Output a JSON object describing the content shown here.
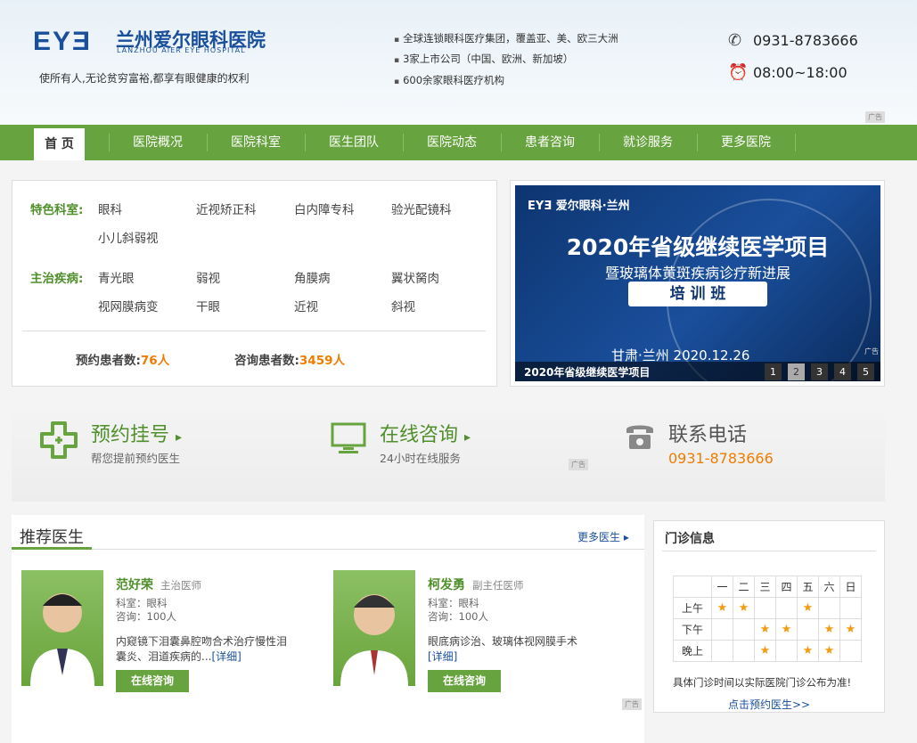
{
  "header": {
    "logo_mark": "EYƎ",
    "hospital_name": "兰州爱尔眼科医院",
    "hospital_name_en": "LANZHOU AIER EYE HOSPITAL",
    "slogan": "使所有人,无论贫穷富裕,都享有眼健康的权利",
    "highlights": [
      "全球连锁眼科医疗集团，覆盖亚、美、欧三大洲",
      "3家上市公司（中国、欧洲、新加坡）",
      "600余家眼科医疗机构"
    ],
    "phone": "0931-8783666",
    "hours": "08:00~18:00",
    "ad_label": "广告"
  },
  "nav": {
    "items": [
      "首 页",
      "医院概况",
      "医院科室",
      "医生团队",
      "医院动态",
      "患者咨询",
      "就诊服务",
      "更多医院"
    ]
  },
  "departments": {
    "featured_label": "特色科室:",
    "featured": [
      "眼科",
      "近视矫正科",
      "白内障专科",
      "验光配镜科",
      "小儿斜弱视"
    ],
    "diseases_label": "主治疾病:",
    "diseases": [
      "青光眼",
      "弱视",
      "角膜病",
      "翼状胬肉",
      "视网膜病变",
      "干眼",
      "近视",
      "斜视"
    ],
    "appt_label": "预约患者数:",
    "appt_count": "76人",
    "consult_label": "咨询患者数:",
    "consult_count": "3459人"
  },
  "banner": {
    "brand": "EYƎ 爱尔眼科·兰州",
    "headline": "2020年省级继续医学项目",
    "subline": "暨玻璃体黄斑疾病诊疗新进展",
    "tag": "培 训 班",
    "place_date": "甘肃·兰州    2020.12.26",
    "caption": "2020年省级继续医学项目",
    "pages": [
      "1",
      "2",
      "3",
      "4",
      "5"
    ],
    "active_page": "2",
    "ad_label": "广告"
  },
  "quick": {
    "appt_title": "预约挂号",
    "appt_sub": "帮您提前预约医生",
    "consult_title": "在线咨询",
    "consult_sub": "24小时在线服务",
    "phone_title": "联系电话",
    "phone_number": "0931-8783666",
    "ad_label": "广告"
  },
  "doctors": {
    "title": "推荐医生",
    "more": "更多医生 ▸",
    "list": [
      {
        "name": "范好荣",
        "title": "主治医师",
        "dept": "科室：眼科",
        "consults": "咨询：100人",
        "desc": "内窥镜下泪囊鼻腔吻合术治疗慢性泪囊炎、泪道疾病的...",
        "detail": "[详细]",
        "button": "在线咨询"
      },
      {
        "name": "柯发勇",
        "title": "副主任医师",
        "dept": "科室：眼科",
        "consults": "咨询：100人",
        "desc": "眼底病诊治、玻璃体视网膜手术",
        "detail": "[详细]",
        "button": "在线咨询"
      }
    ],
    "ad_label": "广告"
  },
  "clinic": {
    "title": "门诊信息",
    "days": [
      "一",
      "二",
      "三",
      "四",
      "五",
      "六",
      "日"
    ],
    "rows": [
      {
        "label": "上午",
        "stars": [
          1,
          1,
          0,
          0,
          1,
          0,
          0
        ]
      },
      {
        "label": "下午",
        "stars": [
          0,
          0,
          1,
          1,
          0,
          1,
          1
        ]
      },
      {
        "label": "晚上",
        "stars": [
          0,
          0,
          1,
          0,
          1,
          1,
          0
        ]
      }
    ],
    "note": "具体门诊时间以实际医院门诊公布为准!",
    "link": "点击预约医生>>"
  }
}
